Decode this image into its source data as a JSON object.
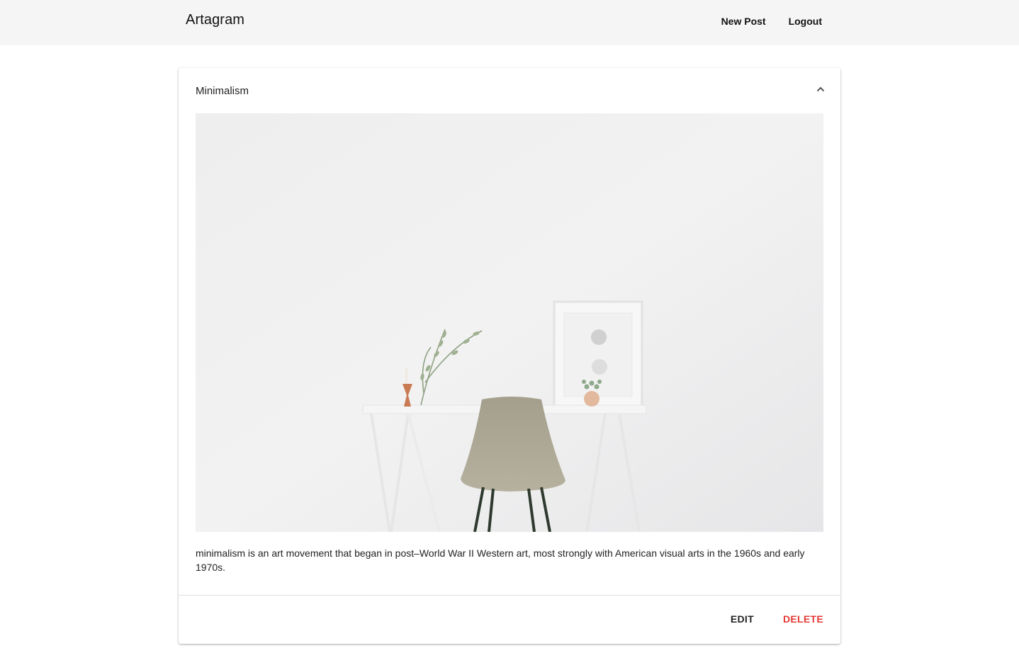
{
  "app": {
    "title": "Artagram"
  },
  "nav": {
    "new_post": "New Post",
    "logout": "Logout"
  },
  "post": {
    "title": "Minimalism",
    "description": "minimalism is an art movement that began in post–World War II Western art, most strongly with American visual arts in the 1960s and early 1970s.",
    "image_alt": "White desk with beige chair, small plants and framed art against a white wall",
    "collapse_icon": "chevron-up-icon"
  },
  "actions": {
    "edit": "EDIT",
    "delete": "DELETE"
  },
  "colors": {
    "topbar": "#f5f5f5",
    "delete": "#e53935"
  }
}
